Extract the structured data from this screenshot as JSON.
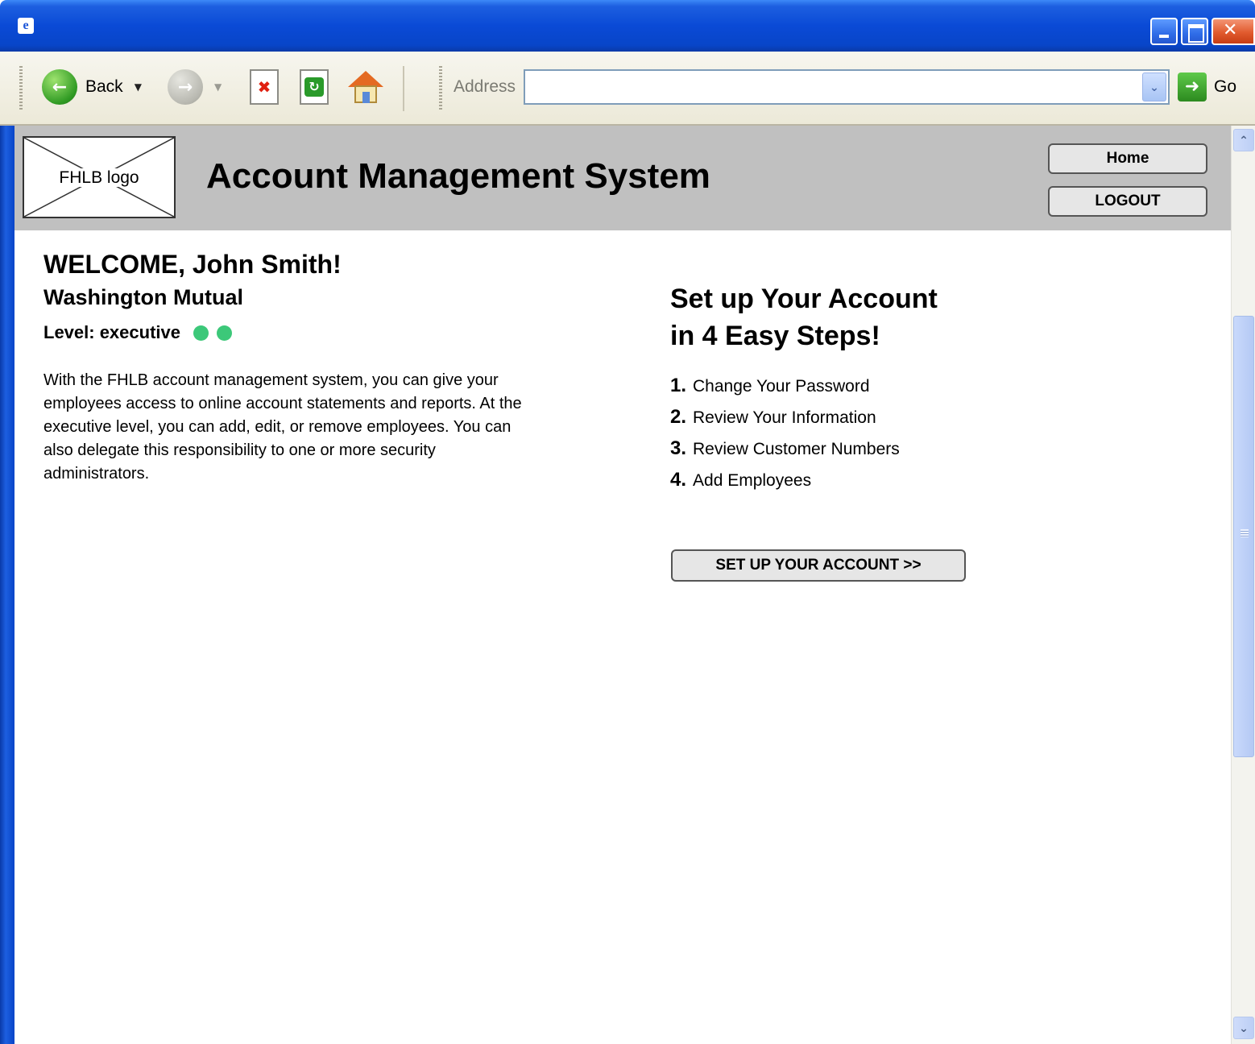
{
  "browser": {
    "back_label": "Back",
    "address_label": "Address",
    "address_value": "",
    "go_label": "Go"
  },
  "header": {
    "logo_label": "FHLB logo",
    "title": "Account Management System",
    "home_button": "Home",
    "logout_button": "LOGOUT"
  },
  "welcome": {
    "greeting": "WELCOME, John Smith!",
    "company": "Washington Mutual",
    "level": "Level: executive",
    "level_dots": 2,
    "level_dot_color": "#3cc879",
    "intro": "With the FHLB account management system, you can give your employees access to online account statements and reports. At the executive level, you can add, edit, or remove employees. You can also delegate this responsibility to one or more security administrators."
  },
  "setup": {
    "title_line1": "Set up Your Account",
    "title_line2": "in 4 Easy Steps!",
    "steps": [
      {
        "num": "1.",
        "label": "Change Your Password"
      },
      {
        "num": "2.",
        "label": "Review Your Information"
      },
      {
        "num": "3.",
        "label": "Review Customer Numbers"
      },
      {
        "num": "4.",
        "label": "Add Employees"
      }
    ],
    "button_label": "SET UP YOUR ACCOUNT >>"
  },
  "colors": {
    "titlebar": "#0a4ad6",
    "header_band": "#c0c0c0",
    "button_fill": "#e6e6e6"
  }
}
